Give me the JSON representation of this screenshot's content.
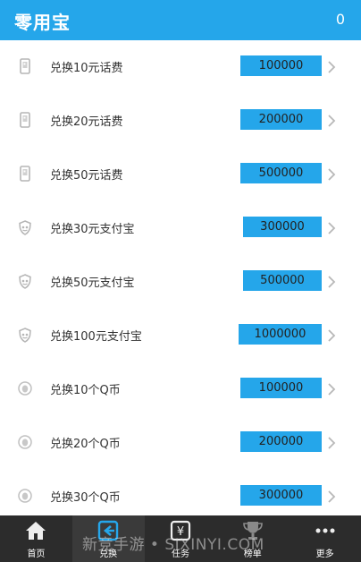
{
  "header": {
    "title": "零用宝",
    "count": "0"
  },
  "items": [
    {
      "label": "兑换10元话费",
      "cost": "100000",
      "icon": "phone-icon"
    },
    {
      "label": "兑换20元话费",
      "cost": "200000",
      "icon": "phone-icon"
    },
    {
      "label": "兑换50元话费",
      "cost": "500000",
      "icon": "phone-icon"
    },
    {
      "label": "兑换30元支付宝",
      "cost": "300000",
      "icon": "alipay-shield-icon"
    },
    {
      "label": "兑换50元支付宝",
      "cost": "500000",
      "icon": "alipay-shield-icon"
    },
    {
      "label": "兑换100元支付宝",
      "cost": "1000000",
      "icon": "alipay-shield-icon"
    },
    {
      "label": "兑换10个Q币",
      "cost": "100000",
      "icon": "qq-penguin-icon"
    },
    {
      "label": "兑换20个Q币",
      "cost": "200000",
      "icon": "qq-penguin-icon"
    },
    {
      "label": "兑换30个Q币",
      "cost": "300000",
      "icon": "qq-penguin-icon"
    }
  ],
  "tabs": [
    {
      "label": "首页",
      "icon": "home-icon"
    },
    {
      "label": "兑换",
      "icon": "exchange-icon",
      "active": true
    },
    {
      "label": "任务",
      "icon": "yuan-icon"
    },
    {
      "label": "榜单",
      "icon": "trophy-icon"
    },
    {
      "label": "更多",
      "icon": "more-icon"
    }
  ],
  "watermark": "新竞手游 • SIXINYI.COM",
  "colors": {
    "accent": "#25a6ea",
    "tabbar": "#2c2c2c"
  }
}
